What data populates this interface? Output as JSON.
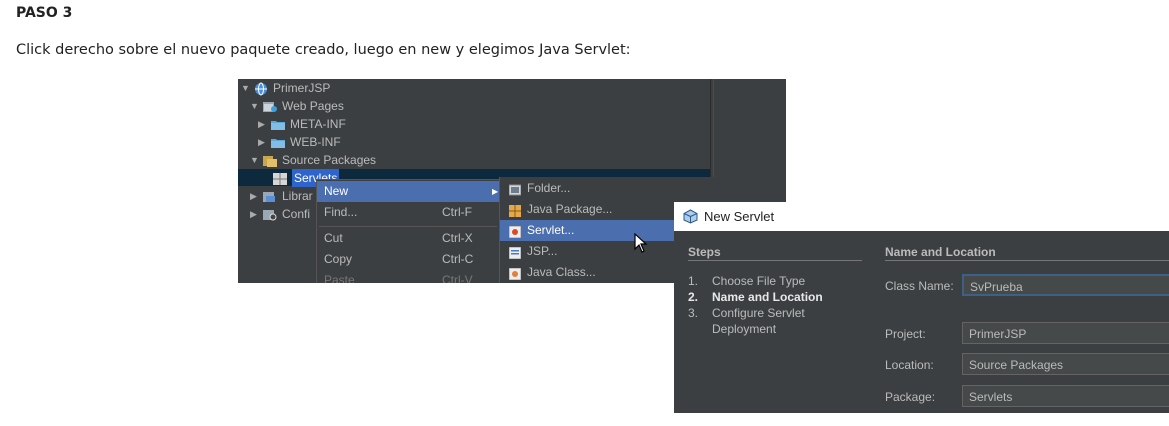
{
  "doc": {
    "heading": "PASO 3",
    "instruction": "Click derecho sobre el nuevo paquete creado, luego en new y elegimos Java Servlet:"
  },
  "tree": {
    "project": "PrimerJSP",
    "web_pages": "Web Pages",
    "meta_inf": "META-INF",
    "web_inf": "WEB-INF",
    "source_packages": "Source Packages",
    "servlets": "Servlets",
    "libraries": "Librar",
    "config": "Confi"
  },
  "context_menu": {
    "items": [
      {
        "label": "New",
        "shortcut": ""
      },
      {
        "label": "Find...",
        "shortcut": "Ctrl-F"
      },
      {
        "label": "Cut",
        "shortcut": "Ctrl-X"
      },
      {
        "label": "Copy",
        "shortcut": "Ctrl-C"
      },
      {
        "label": "Paste",
        "shortcut": "Ctrl-V"
      }
    ],
    "submenu": [
      {
        "label": "Folder..."
      },
      {
        "label": "Java Package..."
      },
      {
        "label": "Servlet..."
      },
      {
        "label": "JSP..."
      },
      {
        "label": "Java Class..."
      }
    ]
  },
  "dialog": {
    "title": "New Servlet",
    "steps_heading": "Steps",
    "steps": [
      {
        "num": "1.",
        "label": "Choose File Type"
      },
      {
        "num": "2.",
        "label": "Name and Location"
      },
      {
        "num": "3.",
        "label": "Configure Servlet"
      }
    ],
    "step3_cont": "Deployment",
    "section_heading": "Name and Location",
    "class_name_label": "Class Name:",
    "class_name_value": "SvPrueba",
    "project_label": "Project:",
    "project_value": "PrimerJSP",
    "location_label": "Location:",
    "location_value": "Source Packages",
    "package_label": "Package:",
    "package_value": "Servlets"
  },
  "colors": {
    "ide_bg": "#3c3f41",
    "menu_highlight": "#4b6eaf",
    "selection": "#2f65ca"
  }
}
